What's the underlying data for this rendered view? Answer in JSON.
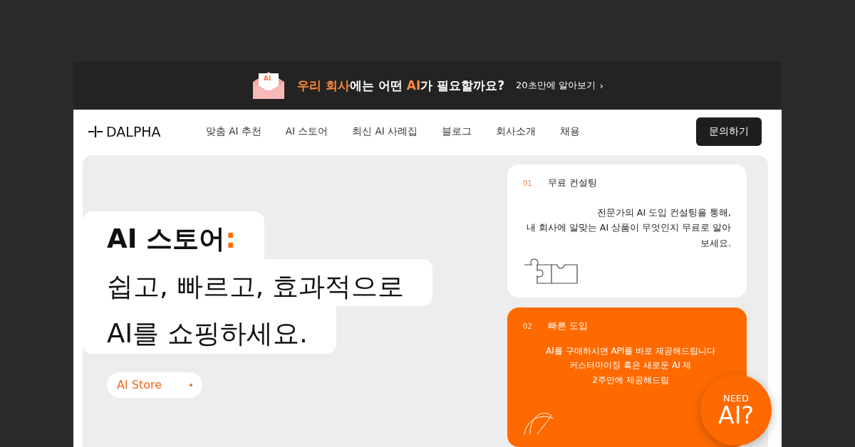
{
  "banner": {
    "headline": [
      {
        "text": "우리 회사",
        "accent": true
      },
      {
        "text": "에는 어떤 ",
        "accent": false
      },
      {
        "text": "AI",
        "accent": true
      },
      {
        "text": "가 필요할까요?",
        "accent": false
      }
    ],
    "envelope_label": "AI",
    "link": "20초만에 알아보기",
    "link_arrow": "›"
  },
  "nav": {
    "logo": "DALPHA",
    "items": [
      "맞춤 AI 추천",
      "AI 스토어",
      "최신 AI 사례집",
      "블로그",
      "회사소개",
      "채용"
    ],
    "cta": "문의하기"
  },
  "hero": {
    "title": "AI 스토어",
    "title_mark": ":",
    "lines": [
      "쉽고, 빠르고, 효과적으로",
      "AI를 쇼핑하세요."
    ],
    "tag": "AI Store"
  },
  "cards": [
    {
      "kind": "light",
      "number": "01",
      "title": "무료 컨설팅",
      "text": "전문가의 AI 도입 컨설팅을 통해,\n내 회사에 알맞는 AI 상품이 무엇인지 무료로 알아\n보세요."
    },
    {
      "kind": "accent",
      "number": "02",
      "title": "빠른 도입",
      "text": "AI를 구매하시면 API를 바로 제공해드립니다\n커스터마이징 혹은 새로운 AI 제\n2주만에 제공해드립"
    }
  ],
  "badge": {
    "small": "NEED",
    "big": "AI?"
  }
}
